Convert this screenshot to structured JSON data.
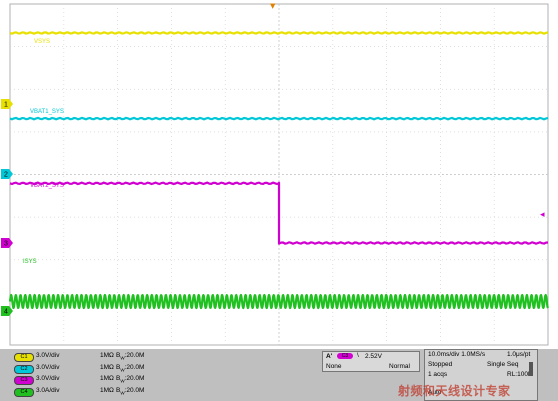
{
  "chart_data": {
    "type": "line",
    "x_unit": "ms",
    "xlim": [
      -50,
      50
    ],
    "grid": true,
    "series": [
      {
        "name": "VSYS",
        "color": "#e8e000",
        "x": [
          -50,
          50
        ],
        "y": [
          5.0,
          5.0
        ]
      },
      {
        "name": "VBAT1_SYS",
        "color": "#00c8d8",
        "x": [
          -50,
          50
        ],
        "y": [
          3.9,
          3.9
        ]
      },
      {
        "name": "VBAT2_SYS",
        "color": "#d000d0",
        "x": [
          -50,
          0,
          0,
          50
        ],
        "y": [
          4.2,
          4.2,
          0.0,
          0.0
        ]
      },
      {
        "name": "ISYS",
        "color": "#20c020"
      }
    ]
  },
  "markers": {
    "ch1": "1",
    "ch2": "2",
    "ch3": "3",
    "ch4": "4",
    "trigger_right": "◂",
    "trigger_top": "▼"
  },
  "channels": [
    {
      "badge": "C1",
      "scale": "3.0V/div",
      "impedance": "1MΩ",
      "bw": "B",
      "bw_sub": "W",
      "bw_val": ":20.0M",
      "color": "#e8e000"
    },
    {
      "badge": "C2",
      "scale": "3.0V/div",
      "impedance": "1MΩ",
      "bw": "B",
      "bw_sub": "W",
      "bw_val": ":20.0M",
      "color": "#00c8d8"
    },
    {
      "badge": "C3",
      "scale": "3.0V/div",
      "impedance": "1MΩ",
      "bw": "B",
      "bw_sub": "W",
      "bw_val": ":20.0M",
      "color": "#d000d0"
    },
    {
      "badge": "C4",
      "scale": "3.0A/div",
      "impedance": "1MΩ",
      "bw": "B",
      "bw_sub": "W",
      "bw_val": ":20.0M",
      "color": "#20c020"
    }
  ],
  "trigger": {
    "label": "A'",
    "channel": "C3",
    "slope": "\\",
    "level": "2.52V",
    "mode_left": "None",
    "mode_right": "Normal"
  },
  "timebase": {
    "horizontal": "10.0ms/div 1.0MS/s",
    "resolution": "1.0μs/pt",
    "state": "Stopped",
    "seq": "Single Seq",
    "acqs": "1 acqs",
    "rl": "RL:100k",
    "auto": "Auto"
  },
  "watermark": "射频和天线设计专家"
}
